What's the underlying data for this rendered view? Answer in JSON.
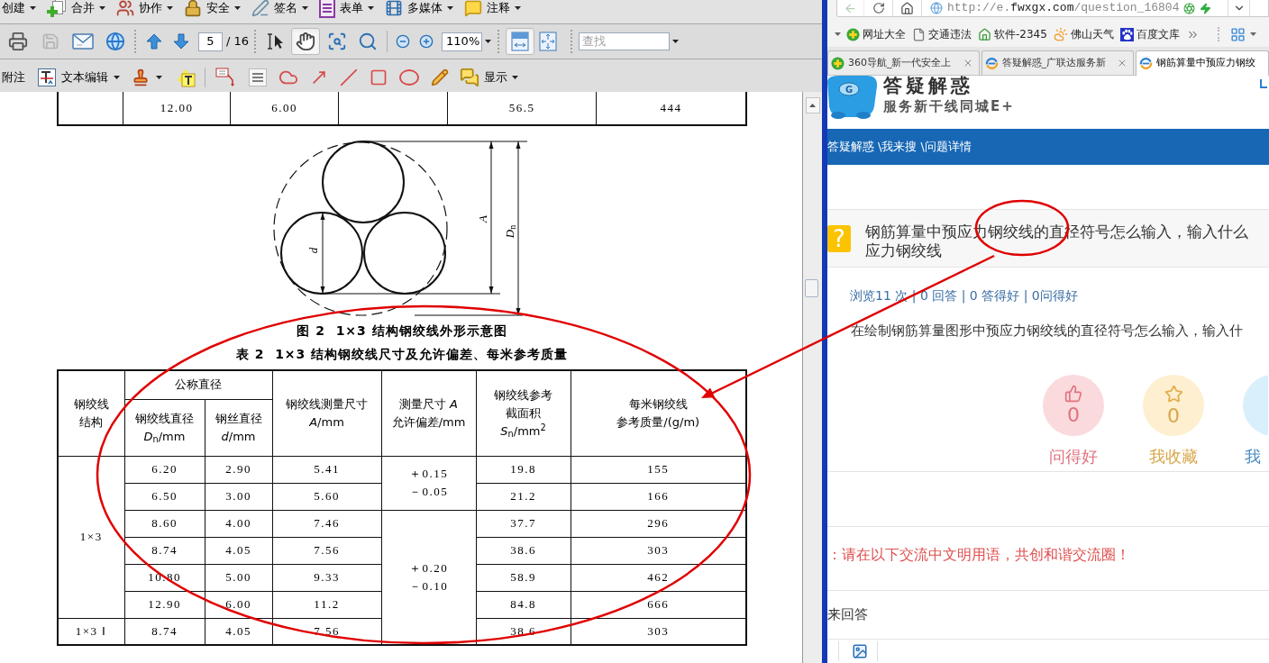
{
  "pdf_menu": [
    {
      "label": "创建"
    },
    {
      "label": "合并"
    },
    {
      "label": "协作"
    },
    {
      "label": "安全"
    },
    {
      "label": "签名"
    },
    {
      "label": "表单"
    },
    {
      "label": "多媒体"
    },
    {
      "label": "注释"
    }
  ],
  "pdf_toolbar": {
    "file_tools": [
      {
        "disabled": false
      },
      {
        "disabled": true
      },
      {
        "disabled": false
      },
      {
        "disabled": false
      }
    ],
    "page_field": "5",
    "page_count": "/ 16",
    "tool_modes": [
      {
        "selected": false
      },
      {
        "selected": true
      },
      {
        "selected": false
      },
      {
        "selected": false
      }
    ],
    "zoom_field": "110%",
    "view_modes": [
      {
        "selected": true
      },
      {
        "selected": false
      }
    ],
    "search_placeholder": "查找"
  },
  "comment_toolbar": {
    "label": "附注",
    "text_edit": "文本编辑",
    "show": "显示"
  },
  "document": {
    "previous_row": {
      "column_2": "12.00",
      "column_3": "6.00",
      "column_5": "56.5",
      "column_6": "444"
    },
    "figure": {
      "label_d": "*d*",
      "label_a": "*A*",
      "label_dn": "*D*$_{n}$",
      "caption": "图 2  1×3 结构钢绞线外形示意图"
    },
    "table": {
      "caption": "表 2  1×3 结构钢绞线尺寸及允许偏差、每米参考质量",
      "header": {
        "structure": [
          "钢绞线",
          "结构"
        ],
        "nominal": "公称直径",
        "strand": [
          "钢绞线直径",
          "*D*$_{n}$/mm"
        ],
        "wire": [
          "钢丝直径",
          "*d*/mm"
        ],
        "measured": [
          "钢绞线测量尺寸",
          "*A*/mm"
        ],
        "tolerance": [
          "测量尺寸 *A*",
          "允许偏差/mm"
        ],
        "area": [
          "钢绞线参考",
          "截面积",
          "*S*$_{n}$/mm$^{2}$"
        ],
        "mass": [
          "每米钢绞线",
          "参考质量/(g/m)"
        ]
      },
      "rows": [
        {
          "structure": "1×3",
          "strand": "6.20",
          "wire": "2.90",
          "measured": "5.41",
          "tolerance": [
            "＋0.15",
            "－0.05"
          ],
          "area": "19.8",
          "mass": "155"
        },
        {
          "strand": "6.50",
          "wire": "3.00",
          "measured": "5.60",
          "area": "21.2",
          "mass": "166"
        },
        {
          "strand": "8.60",
          "wire": "4.00",
          "measured": "7.46",
          "tolerance": [
            "＋0.20",
            "－0.10"
          ],
          "area": "37.7",
          "mass": "296"
        },
        {
          "strand": "8.74",
          "wire": "4.05",
          "measured": "7.56",
          "area": "38.6",
          "mass": "303"
        },
        {
          "strand": "10.80",
          "wire": "5.00",
          "measured": "9.33",
          "area": "58.9",
          "mass": "462"
        },
        {
          "strand": "12.90",
          "wire": "6.00",
          "measured": "11.2",
          "area": "84.8",
          "mass": "666"
        },
        {
          "structure": "1×3 Ⅰ",
          "strand": "8.74",
          "wire": "4.05",
          "measured": "7.56",
          "area": "38.6",
          "mass": "303"
        }
      ]
    }
  },
  "browser": {
    "back": {
      "disabled": true
    },
    "address": "http://e.**fwxgx.com**/question_16804",
    "bookmarks": [
      "网址大全",
      "交通违法",
      "软件-2345",
      "佛山天气",
      "百度文库"
    ],
    "tabs": [
      {
        "title": "360导航_新一代安全上",
        "selected": false
      },
      {
        "title": "答疑解惑_广联达服务新",
        "selected": false
      },
      {
        "title": "钢筋算量中预应力钢绞",
        "selected": true
      }
    ],
    "page": {
      "mascot_letter": "G",
      "site_title": "答疑解惑",
      "slogan": "服务新干线同城E+",
      "breadcrumb": [
        "答疑解惑",
        "\\我来搜",
        "\\问题详情"
      ],
      "question": {
        "badge": "?",
        "title_lines": [
          "钢筋算量中预应力钢绞线的直径符号怎么输入，输入什么",
          "应力钢绞线"
        ],
        "stats": "浏览11 次 | 0 回答 | 0 答得好 | 0问得好",
        "description": "在绘制钢筋算量图形中预应力钢绞线的直径符号怎么输入，输入什"
      },
      "actions": [
        {
          "kind": "like",
          "count": "0",
          "label": "问得好"
        },
        {
          "kind": "favorite",
          "count": "0",
          "label": "我收藏"
        },
        {
          "kind": "share",
          "label": "我"
        }
      ],
      "notice": "：请在以下交流中文明用语，共创和谐交流圈！",
      "answer_heading": "来回答"
    }
  }
}
